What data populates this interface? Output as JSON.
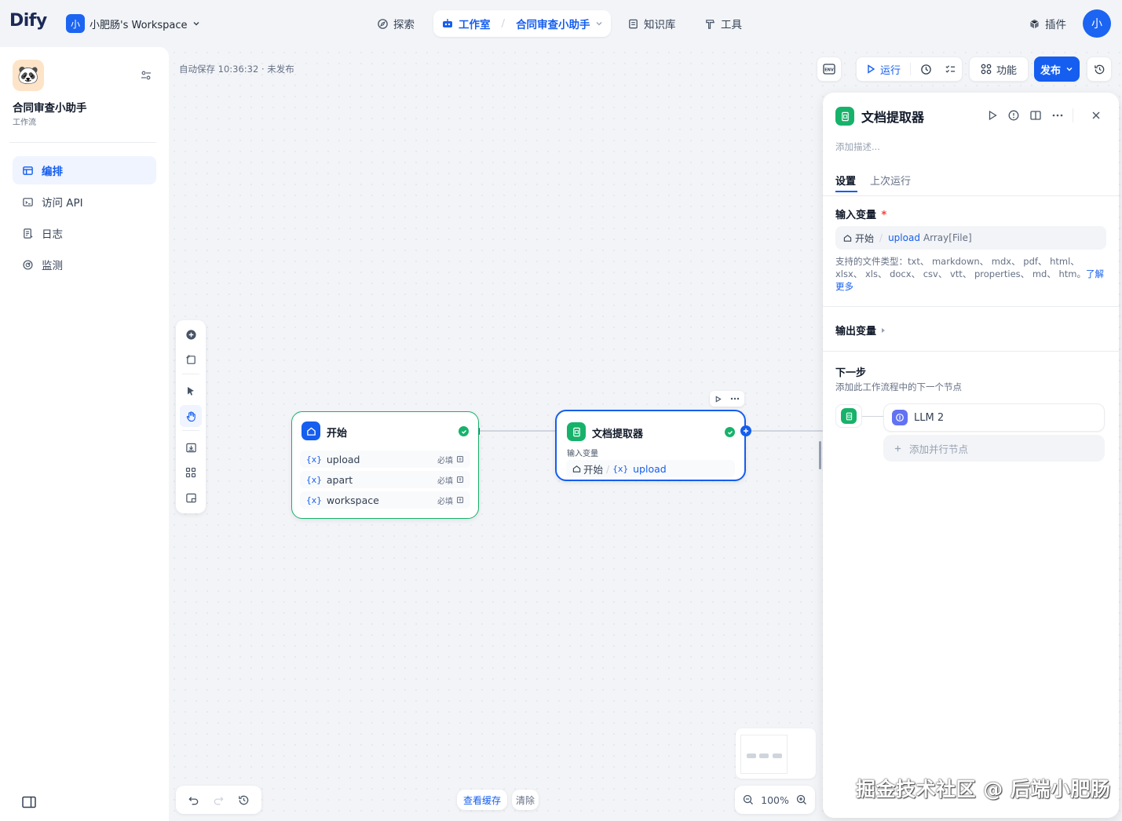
{
  "brand": {
    "logo_text": "Dify",
    "logo_dot": "i"
  },
  "workspace": {
    "avatar": "小",
    "name": "小肥肠's Workspace"
  },
  "nav": {
    "explore": "探索",
    "studio": "工作室",
    "app_breadcrumb": "合同审查小助手",
    "knowledge": "知识库",
    "tools": "工具",
    "plugins": "插件",
    "user_avatar": "小"
  },
  "sidebar": {
    "app_icon": "🐼",
    "app_name": "合同审查小助手",
    "app_type": "工作流",
    "items": [
      {
        "label": "编排",
        "icon": "layout-icon",
        "active": true
      },
      {
        "label": "访问 API",
        "icon": "terminal-icon",
        "active": false
      },
      {
        "label": "日志",
        "icon": "log-icon",
        "active": false
      },
      {
        "label": "监测",
        "icon": "monitor-icon",
        "active": false
      }
    ]
  },
  "canvas": {
    "autosave": "自动保存 10:36:32 · 未发布",
    "toolbar": {
      "env": "ENV",
      "run": "运行",
      "features": "功能",
      "publish": "发布"
    },
    "start_node": {
      "title": "开始",
      "variables": [
        {
          "name": "upload",
          "required": "必填"
        },
        {
          "name": "apart",
          "required": "必填"
        },
        {
          "name": "workspace",
          "required": "必填"
        }
      ]
    },
    "extractor_node": {
      "title": "文档提取器",
      "input_label": "输入变量",
      "input_source": "开始",
      "input_var": "upload"
    },
    "bottom": {
      "view_cache": "查看缓存",
      "clear": "清除",
      "zoom": "100%"
    }
  },
  "panel": {
    "title": "文档提取器",
    "description_placeholder": "添加描述...",
    "tabs": [
      "设置",
      "上次运行"
    ],
    "input_section": "输入变量",
    "required_mark": "*",
    "input_source": "开始",
    "input_var": "upload",
    "input_type": "Array[File]",
    "supported_types": "支持的文件类型：txt、 markdown、 mdx、 pdf、 html、 xlsx、 xls、 docx、 csv、 vtt、 properties、 md、 htm。",
    "learn_more": "了解更多",
    "output_section": "输出变量",
    "next_step_title": "下一步",
    "next_step_desc": "添加此工作流程中的下一个节点",
    "next_node": "LLM 2",
    "add_parallel": "添加并行节点"
  },
  "watermark": "掘金技术社区 @ 后端小肥肠",
  "colors": {
    "primary": "#155eef",
    "success": "#17b26a",
    "start_green": "#17b26a"
  }
}
